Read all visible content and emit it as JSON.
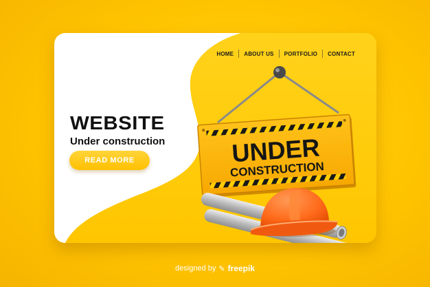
{
  "nav": {
    "items": [
      {
        "label": "HOME"
      },
      {
        "label": "ABOUT US"
      },
      {
        "label": "PORTFOLIO"
      },
      {
        "label": "CONTACT"
      }
    ]
  },
  "hero": {
    "title": "WEBSITE",
    "subtitle": "Under construction",
    "cta_label": "READ MORE"
  },
  "sign": {
    "line1": "UNDER",
    "line2": "CONSTRUCTION"
  },
  "footer": {
    "prefix": "designed by",
    "brand": "freepik",
    "logo_icon": "freepik-logo-icon"
  },
  "colors": {
    "background": "#ffc400",
    "panel_white": "#ffffff",
    "sign_orange": "#ffb400",
    "helmet": "#ff6a1a",
    "text_dark": "#111111",
    "cta": "#ffc000"
  },
  "icons": [
    "freepik-logo-icon",
    "hardhat-icon",
    "pipes-icon",
    "nail-icon"
  ]
}
